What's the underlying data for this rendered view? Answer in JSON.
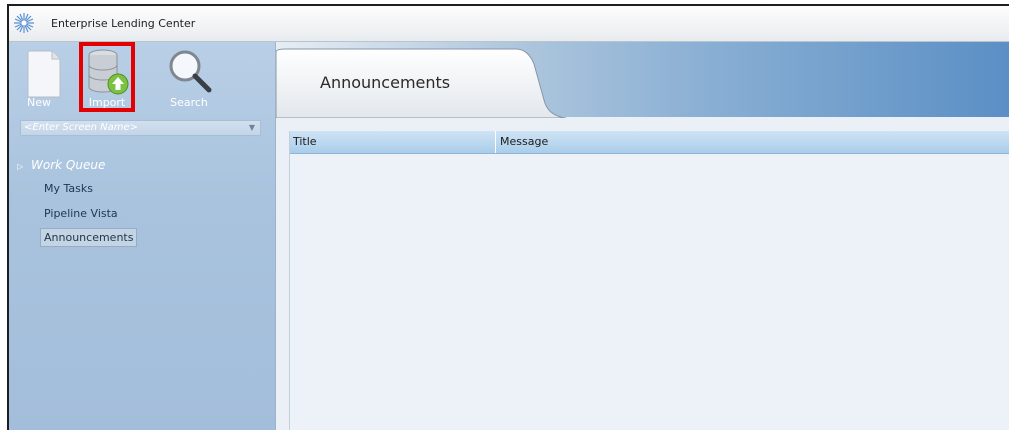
{
  "window": {
    "title": "Enterprise Lending Center",
    "logo_icon": "sunburst-logo-icon"
  },
  "toolbar": {
    "new_label": "New",
    "import_label": "Import",
    "search_label": "Search",
    "highlight_color": "#e20000"
  },
  "screen_selector": {
    "placeholder": "<Enter Screen Name>"
  },
  "navigation": {
    "group_label": "Work Queue",
    "items": [
      {
        "label": "My Tasks",
        "selected": false
      },
      {
        "label": "Pipeline Vista",
        "selected": false
      },
      {
        "label": "Announcements",
        "selected": true
      }
    ]
  },
  "main": {
    "tab_label": "Announcements",
    "grid": {
      "columns": [
        "Title",
        "Message"
      ],
      "rows": []
    }
  }
}
